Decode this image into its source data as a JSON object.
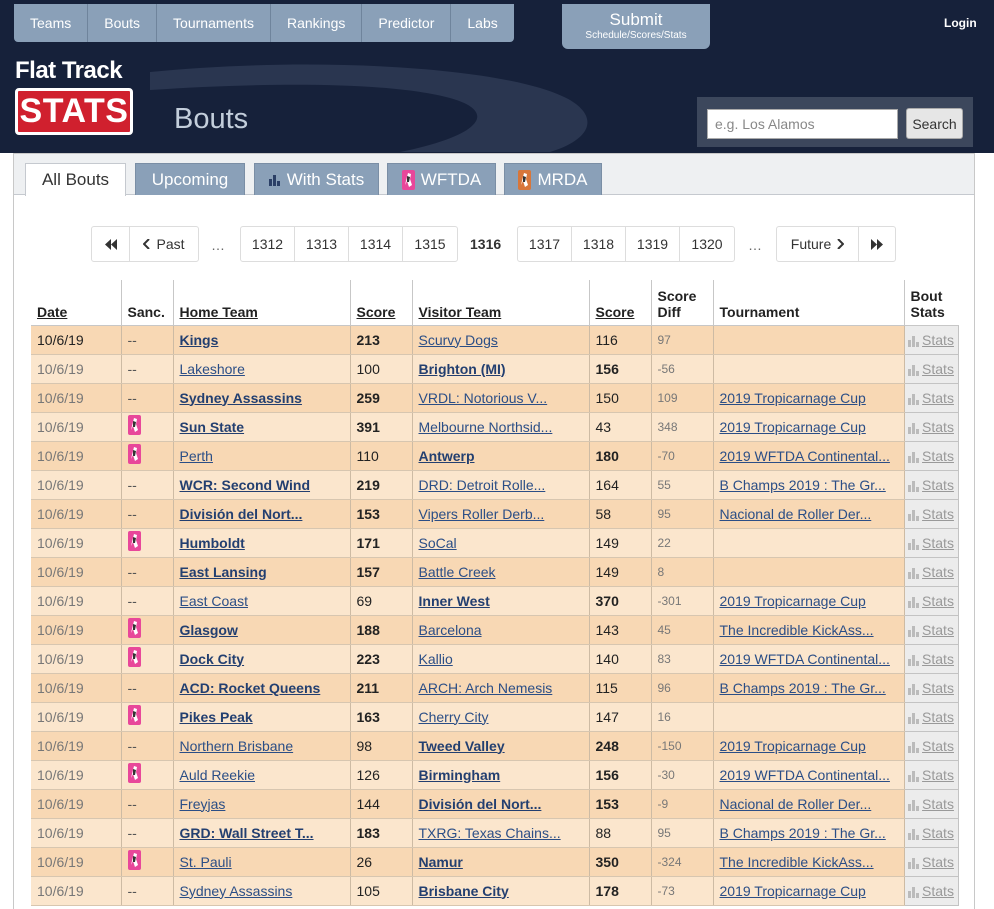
{
  "nav": {
    "items": [
      "Teams",
      "Bouts",
      "Tournaments",
      "Rankings",
      "Predictor",
      "Labs"
    ],
    "submit_title": "Submit",
    "submit_sub": "Schedule/Scores/Stats",
    "login": "Login"
  },
  "logo": {
    "line1": "Flat Track",
    "line2": "STATS"
  },
  "page_title": "Bouts",
  "search": {
    "placeholder": "e.g. Los Alamos",
    "button": "Search"
  },
  "tabs": [
    "All Bouts",
    "Upcoming",
    "With Stats",
    "WFTDA",
    "MRDA"
  ],
  "pager": {
    "past": "Past",
    "future": "Future",
    "ellipsis": "…",
    "pages_before": [
      "1312",
      "1313",
      "1314",
      "1315"
    ],
    "current": "1316",
    "pages_after": [
      "1317",
      "1318",
      "1319",
      "1320"
    ]
  },
  "table": {
    "headers": {
      "date": "Date",
      "sanc": "Sanc.",
      "home": "Home Team",
      "score1": "Score",
      "visitor": "Visitor Team",
      "score2": "Score",
      "diff_line1": "Score",
      "diff_line2": "Diff",
      "tournament": "Tournament",
      "stats_line1": "Bout",
      "stats_line2": "Stats"
    },
    "stats_label": "Stats",
    "rows": [
      {
        "date": "10/6/19",
        "sanc": false,
        "home": "Kings",
        "home_score": "213",
        "visitor": "Scurvy Dogs",
        "visitor_score": "116",
        "diff": "97",
        "tournament": ""
      },
      {
        "date": "10/6/19",
        "sanc": false,
        "home": "Lakeshore",
        "home_score": "100",
        "visitor": "Brighton (MI)",
        "visitor_score": "156",
        "diff": "-56",
        "tournament": ""
      },
      {
        "date": "10/6/19",
        "sanc": false,
        "home": "Sydney Assassins",
        "home_score": "259",
        "visitor": "VRDL: Notorious V...",
        "visitor_score": "150",
        "diff": "109",
        "tournament": "2019 Tropicarnage Cup"
      },
      {
        "date": "10/6/19",
        "sanc": true,
        "home": "Sun State",
        "home_score": "391",
        "visitor": "Melbourne Northsid...",
        "visitor_score": "43",
        "diff": "348",
        "tournament": "2019 Tropicarnage Cup"
      },
      {
        "date": "10/6/19",
        "sanc": true,
        "home": "Perth",
        "home_score": "110",
        "visitor": "Antwerp",
        "visitor_score": "180",
        "diff": "-70",
        "tournament": "2019 WFTDA Continental..."
      },
      {
        "date": "10/6/19",
        "sanc": false,
        "home": "WCR: Second Wind",
        "home_score": "219",
        "visitor": "DRD: Detroit Rolle...",
        "visitor_score": "164",
        "diff": "55",
        "tournament": "B Champs 2019 : The Gr..."
      },
      {
        "date": "10/6/19",
        "sanc": false,
        "home": "División del Nort...",
        "home_score": "153",
        "visitor": "Vipers Roller Derb...",
        "visitor_score": "58",
        "diff": "95",
        "tournament": "Nacional de Roller Der..."
      },
      {
        "date": "10/6/19",
        "sanc": true,
        "home": "Humboldt",
        "home_score": "171",
        "visitor": "SoCal",
        "visitor_score": "149",
        "diff": "22",
        "tournament": ""
      },
      {
        "date": "10/6/19",
        "sanc": false,
        "home": "East Lansing",
        "home_score": "157",
        "visitor": "Battle Creek",
        "visitor_score": "149",
        "diff": "8",
        "tournament": ""
      },
      {
        "date": "10/6/19",
        "sanc": false,
        "home": "East Coast",
        "home_score": "69",
        "visitor": "Inner West",
        "visitor_score": "370",
        "diff": "-301",
        "tournament": "2019 Tropicarnage Cup"
      },
      {
        "date": "10/6/19",
        "sanc": true,
        "home": "Glasgow",
        "home_score": "188",
        "visitor": "Barcelona",
        "visitor_score": "143",
        "diff": "45",
        "tournament": "The Incredible KickAss..."
      },
      {
        "date": "10/6/19",
        "sanc": true,
        "home": "Dock City",
        "home_score": "223",
        "visitor": "Kallio",
        "visitor_score": "140",
        "diff": "83",
        "tournament": "2019 WFTDA Continental..."
      },
      {
        "date": "10/6/19",
        "sanc": false,
        "home": "ACD: Rocket Queens",
        "home_score": "211",
        "visitor": "ARCH: Arch Nemesis",
        "visitor_score": "115",
        "diff": "96",
        "tournament": "B Champs 2019 : The Gr..."
      },
      {
        "date": "10/6/19",
        "sanc": true,
        "home": "Pikes Peak",
        "home_score": "163",
        "visitor": "Cherry City",
        "visitor_score": "147",
        "diff": "16",
        "tournament": ""
      },
      {
        "date": "10/6/19",
        "sanc": false,
        "home": "Northern Brisbane",
        "home_score": "98",
        "visitor": "Tweed Valley",
        "visitor_score": "248",
        "diff": "-150",
        "tournament": "2019 Tropicarnage Cup"
      },
      {
        "date": "10/6/19",
        "sanc": true,
        "home": "Auld Reekie",
        "home_score": "126",
        "visitor": "Birmingham",
        "visitor_score": "156",
        "diff": "-30",
        "tournament": "2019 WFTDA Continental..."
      },
      {
        "date": "10/6/19",
        "sanc": false,
        "home": "Freyjas",
        "home_score": "144",
        "visitor": "División del Nort...",
        "visitor_score": "153",
        "diff": "-9",
        "tournament": "Nacional de Roller Der..."
      },
      {
        "date": "10/6/19",
        "sanc": false,
        "home": "GRD: Wall Street T...",
        "home_score": "183",
        "visitor": "TXRG: Texas Chains...",
        "visitor_score": "88",
        "diff": "95",
        "tournament": "B Champs 2019 : The Gr..."
      },
      {
        "date": "10/6/19",
        "sanc": true,
        "home": "St. Pauli",
        "home_score": "26",
        "visitor": "Namur",
        "visitor_score": "350",
        "diff": "-324",
        "tournament": "The Incredible KickAss..."
      },
      {
        "date": "10/6/19",
        "sanc": false,
        "home": "Sydney Assassins",
        "home_score": "105",
        "visitor": "Brisbane City",
        "visitor_score": "178",
        "diff": "-73",
        "tournament": "2019 Tropicarnage Cup"
      }
    ],
    "unsanctioned_mark": "--"
  },
  "colors": {
    "header_bg": "#16213a",
    "nav_bg": "#8aa0b8",
    "logo_red": "#d0202e",
    "row_odd": "#f8d8b4",
    "row_even": "#fbe6cd",
    "link": "#2b4e86",
    "wftda_pink": "#e8479a"
  }
}
